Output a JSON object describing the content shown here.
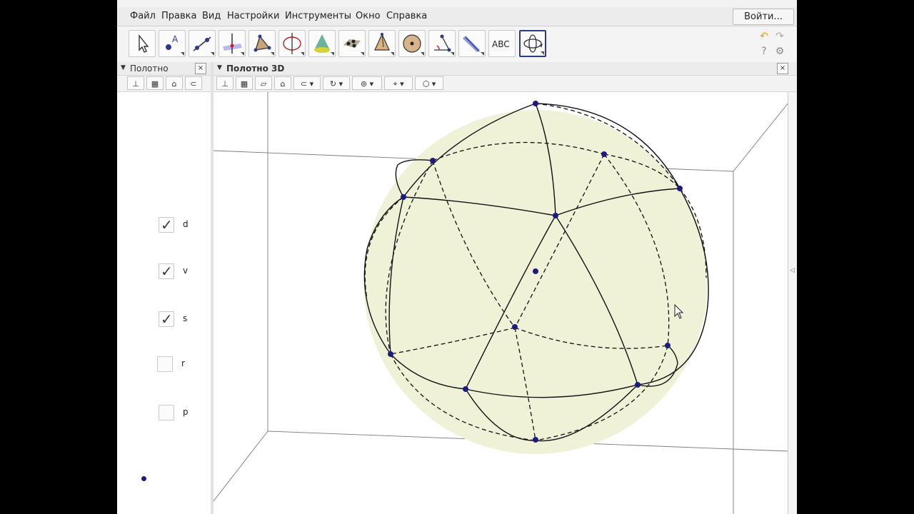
{
  "menubar": {
    "items": [
      "Файл",
      "Правка",
      "Вид",
      "Настройки",
      "Инструменты",
      "Окно",
      "Справка"
    ],
    "login_label": "Войти..."
  },
  "toolbar": {
    "tools": [
      {
        "name": "move-tool-icon"
      },
      {
        "name": "point-tool-icon"
      },
      {
        "name": "line-tool-icon"
      },
      {
        "name": "perpendicular-line-tool-icon"
      },
      {
        "name": "polygon-tool-icon"
      },
      {
        "name": "circle-around-line-tool-icon"
      },
      {
        "name": "intersect-surfaces-tool-icon"
      },
      {
        "name": "plane-through-points-tool-icon"
      },
      {
        "name": "pyramid-tool-icon"
      },
      {
        "name": "sphere-tool-icon"
      },
      {
        "name": "angle-tool-icon"
      },
      {
        "name": "reflect-about-plane-tool-icon"
      },
      {
        "name": "text-tool-icon",
        "label": "ABC"
      },
      {
        "name": "rotate-3d-view-tool-icon"
      }
    ],
    "undo_icon": "undo-icon",
    "redo_icon": "redo-icon",
    "help_icon": "help-icon",
    "settings_icon": "gear-icon"
  },
  "algebra_panel": {
    "title": "Полотно",
    "close_label": "×",
    "checkboxes": [
      {
        "label": "d",
        "checked": true
      },
      {
        "label": "v",
        "checked": true
      },
      {
        "label": "s",
        "checked": true
      },
      {
        "label": "r",
        "checked": false
      },
      {
        "label": "p",
        "checked": false
      }
    ]
  },
  "view3d_panel": {
    "title": "Полотно 3D",
    "close_label": "×"
  },
  "colors": {
    "sphere_fill": "#f0f2d8",
    "point": "#1c1c7f",
    "edge": "#111111",
    "selected_tool_border": "#2d3a84"
  }
}
